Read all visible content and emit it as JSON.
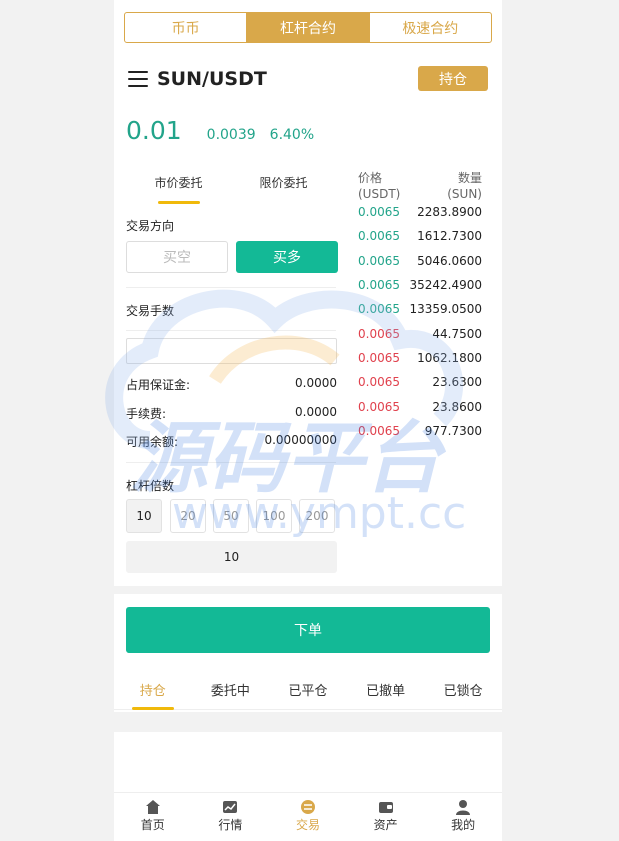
{
  "top_tabs": [
    {
      "label": "币币",
      "active": false
    },
    {
      "label": "杠杆合约",
      "active": true
    },
    {
      "label": "极速合约",
      "active": false
    }
  ],
  "header": {
    "pair": "SUN/USDT",
    "position_button": "持仓"
  },
  "ticker": {
    "price": "0.01",
    "change": "0.0039",
    "change_pct": "6.40%"
  },
  "order_tabs": [
    {
      "label": "市价委托",
      "active": true
    },
    {
      "label": "限价委托",
      "active": false
    }
  ],
  "trade": {
    "direction_label": "交易方向",
    "sell_label": "买空",
    "buy_label": "买多",
    "lots_label": "交易手数",
    "amount_value": "",
    "margin_label": "占用保证金:",
    "margin_value": "0.0000",
    "fee_label": "手续费:",
    "fee_value": "0.0000",
    "balance_label": "可用余额:",
    "balance_value": "0.00000000",
    "leverage_label": "杠杆倍数",
    "leverage_options": [
      "10",
      "20",
      "50",
      "100",
      "200"
    ],
    "leverage_selected": "10",
    "submit_label": "下单"
  },
  "orderbook": {
    "price_header": "价格",
    "price_unit": "(USDT)",
    "qty_header": "数量",
    "qty_unit": "(SUN)",
    "buys": [
      {
        "price": "0.0065",
        "qty": "2283.8900"
      },
      {
        "price": "0.0065",
        "qty": "1612.7300"
      },
      {
        "price": "0.0065",
        "qty": "5046.0600"
      },
      {
        "price": "0.0065",
        "qty": "35242.4900"
      },
      {
        "price": "0.0065",
        "qty": "13359.0500"
      }
    ],
    "sells": [
      {
        "price": "0.0065",
        "qty": "44.7500"
      },
      {
        "price": "0.0065",
        "qty": "1062.1800"
      },
      {
        "price": "0.0065",
        "qty": "23.6300"
      },
      {
        "price": "0.0065",
        "qty": "23.8600"
      },
      {
        "price": "0.0065",
        "qty": "977.7300"
      }
    ]
  },
  "position_tabs": [
    {
      "label": "持仓",
      "active": true
    },
    {
      "label": "委托中",
      "active": false
    },
    {
      "label": "已平仓",
      "active": false
    },
    {
      "label": "已撤单",
      "active": false
    },
    {
      "label": "已锁仓",
      "active": false
    }
  ],
  "bottom_nav": [
    {
      "label": "首页",
      "icon": "home-icon",
      "active": false
    },
    {
      "label": "行情",
      "icon": "chart-icon",
      "active": false
    },
    {
      "label": "交易",
      "icon": "trade-icon",
      "active": true
    },
    {
      "label": "资产",
      "icon": "wallet-icon",
      "active": false
    },
    {
      "label": "我的",
      "icon": "user-icon",
      "active": false
    }
  ],
  "watermark": {
    "text": "源码平台",
    "url": "www.ympt.cc"
  },
  "colors": {
    "gold": "#d9a84a",
    "green": "#13b996",
    "up": "#22a48a",
    "down": "#e0414d",
    "underline": "#f0b90b"
  }
}
